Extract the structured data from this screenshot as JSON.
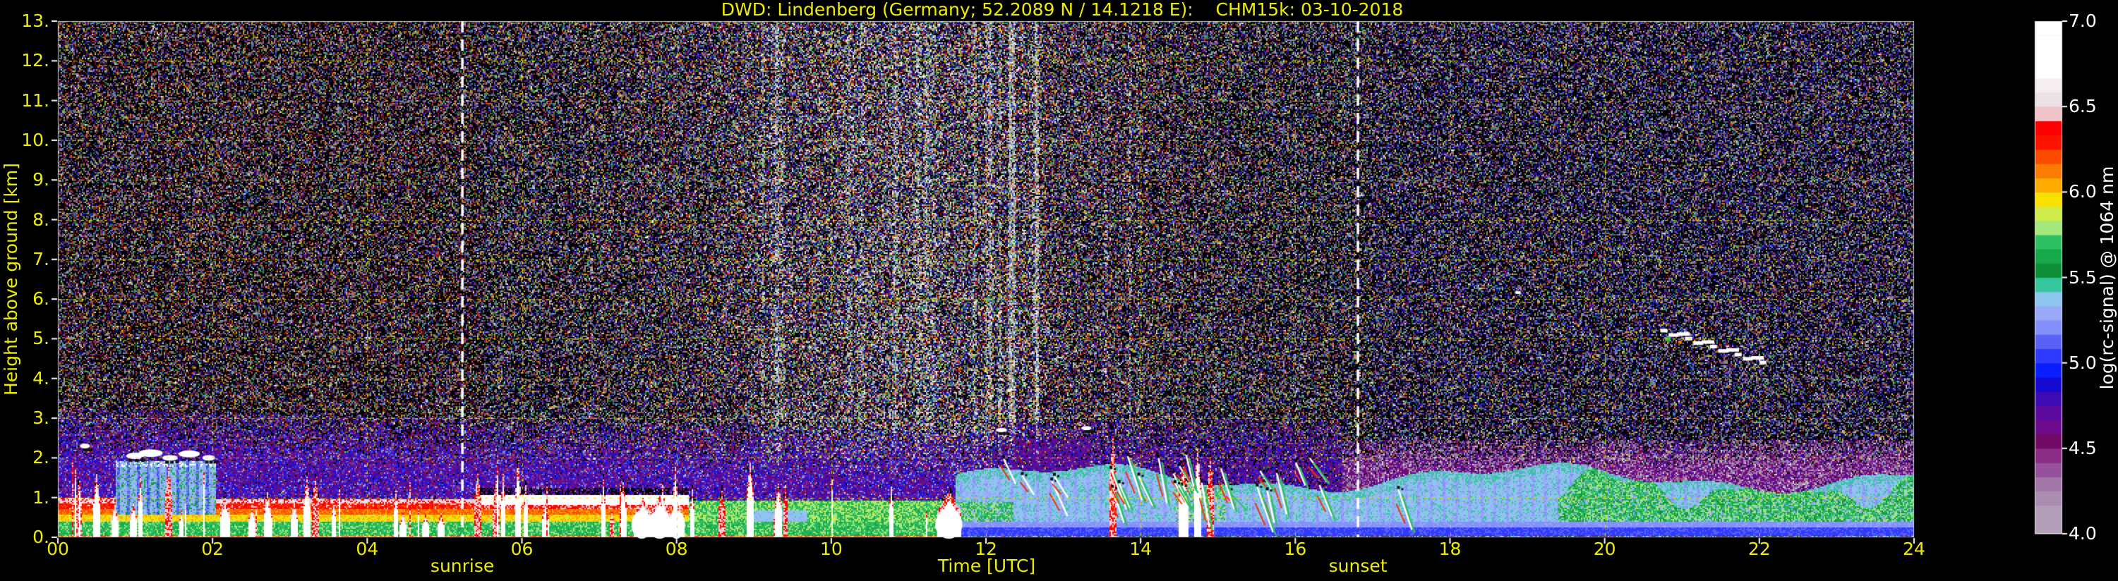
{
  "figure": {
    "background": "#000000",
    "label_color": "#eded00",
    "colorbar_text_color": "#ffffff"
  },
  "chart_data": {
    "type": "heatmap",
    "title": "DWD: Lindenberg (Germany; 52.2089 N / 14.1218 E):    CHM15k: 03-10-2018",
    "station": "Lindenberg (Germany)",
    "latitude": "52.2089 N",
    "longitude": "14.1218 E",
    "instrument": "CHM15k",
    "date": "03-10-2018",
    "xlabel": "Time [UTC]",
    "ylabel": "Height above ground [km]",
    "colorbar_label": "log(rc-signal) @ 1064 nm",
    "xlim": [
      0,
      24
    ],
    "ylim": [
      0,
      13
    ],
    "x_tick_values": [
      0,
      2,
      4,
      6,
      8,
      10,
      12,
      14,
      16,
      18,
      20,
      22,
      24
    ],
    "x_tick_labels": [
      "00",
      "02",
      "04",
      "06",
      "08",
      "10",
      "12",
      "14",
      "16",
      "18",
      "20",
      "22",
      "24"
    ],
    "y_tick_values": [
      0,
      1,
      2,
      3,
      4,
      5,
      6,
      7,
      8,
      9,
      10,
      11,
      12,
      13
    ],
    "y_tick_labels": [
      "0.",
      "1.",
      "2.",
      "3.",
      "4.",
      "5.",
      "6.",
      "7.",
      "8.",
      "9.",
      "10.",
      "11.",
      "12.",
      "13."
    ],
    "colorbar_range": [
      4.0,
      7.0
    ],
    "colorbar_tick_values": [
      4.0,
      4.5,
      5.0,
      5.5,
      6.0,
      6.5,
      7.0
    ],
    "colorbar_tick_labels": [
      "4.0",
      "4.5",
      "5.0",
      "5.5",
      "6.0",
      "6.5",
      "7.0"
    ],
    "colormap_colors": [
      "#b3a0b8",
      "#b3a0b8",
      "#ab8db1",
      "#a277a8",
      "#95519b",
      "#8c2d85",
      "#730b66",
      "#6e0b8c",
      "#5c0b9e",
      "#3c0bb4",
      "#1509d2",
      "#0a1eff",
      "#2f3bff",
      "#5a62f5",
      "#8490fb",
      "#9aa8f8",
      "#8ec6f0",
      "#35c79b",
      "#0e8f3a",
      "#16a849",
      "#2fbf63",
      "#a5e77c",
      "#cfec4a",
      "#f8e000",
      "#fdab00",
      "#fb7c00",
      "#fb4a00",
      "#fa1400",
      "#fa0000",
      "#efc3c8",
      "#ece2e6",
      "#f5eef0",
      "#ffffff",
      "#ffffff",
      "#ffffff",
      "#ffffff"
    ],
    "grid": {
      "color": "#dede00",
      "style": "dashed",
      "x_step_hours": 2,
      "y_step_km": 1
    },
    "annotations": [
      {
        "label": "sunrise",
        "time_utc": 5.23,
        "line_style": "dashed",
        "line_color": "#ffffff"
      },
      {
        "label": "sunset",
        "time_utc": 16.81,
        "line_style": "dashed",
        "line_color": "#ffffff"
      }
    ],
    "layers": {
      "boundary_layer_top_km": {
        "hours": [
          0,
          1,
          2,
          3,
          4,
          5,
          6,
          7,
          8,
          9,
          10,
          11,
          12,
          13,
          14,
          15,
          16,
          17,
          18,
          19,
          20,
          21,
          22,
          23,
          24
        ],
        "top": [
          1.0,
          1.9,
          0.95,
          0.95,
          0.95,
          1.0,
          1.1,
          1.1,
          0.9,
          0.9,
          0.9,
          0.95,
          1.5,
          1.7,
          1.6,
          1.8,
          1.6,
          1.5,
          1.6,
          1.4,
          1.5,
          1.6,
          1.4,
          1.3,
          1.4
        ]
      },
      "noise_bright_band_hours": [
        8.5,
        13.8
      ],
      "purple_noise_band_km": [
        1.0,
        3.2
      ],
      "evening_maroon_band_km": [
        1.4,
        2.45
      ],
      "plumes": [
        {
          "t": 0.25,
          "h": 1.3,
          "w": 2,
          "type": "red"
        },
        {
          "t": 0.5,
          "h": 1.6,
          "w": 2,
          "type": "white"
        },
        {
          "t": 2.15,
          "h": 1.0,
          "w": 3,
          "type": "white"
        },
        {
          "t": 2.5,
          "h": 0.75,
          "w": 2,
          "type": "white"
        },
        {
          "t": 3.05,
          "h": 0.85,
          "w": 2,
          "type": "white"
        },
        {
          "t": 4.45,
          "h": 0.6,
          "w": 2,
          "type": "white"
        },
        {
          "t": 6.3,
          "h": 0.85,
          "w": 2,
          "type": "white"
        },
        {
          "t": 7.55,
          "h": 1.0,
          "w": 6,
          "type": "white"
        },
        {
          "t": 7.78,
          "h": 1.05,
          "w": 7,
          "type": "white"
        },
        {
          "t": 8.0,
          "h": 0.9,
          "w": 5,
          "type": "white"
        },
        {
          "t": 11.52,
          "h": 1.15,
          "w": 8,
          "type": "white"
        },
        {
          "t": 13.63,
          "h": 2.55,
          "w": 2,
          "type": "red"
        },
        {
          "t": 14.55,
          "h": 1.9,
          "w": 3,
          "type": "white"
        },
        {
          "t": 14.72,
          "h": 2.25,
          "w": 2,
          "type": "white"
        },
        {
          "t": 14.9,
          "h": 2.0,
          "w": 2,
          "type": "red"
        }
      ],
      "clouds_low": [
        {
          "t": 0.35,
          "h": 2.3,
          "w": 14,
          "hh": 7
        },
        {
          "t": 1.0,
          "h": 2.05,
          "w": 26,
          "hh": 9
        },
        {
          "t": 1.2,
          "h": 2.12,
          "w": 34,
          "hh": 11
        },
        {
          "t": 1.45,
          "h": 2.0,
          "w": 22,
          "hh": 8
        },
        {
          "t": 1.7,
          "h": 2.1,
          "w": 30,
          "hh": 10
        },
        {
          "t": 1.95,
          "h": 2.0,
          "w": 18,
          "hh": 8
        },
        {
          "t": 12.2,
          "h": 2.7,
          "w": 16,
          "hh": 6
        },
        {
          "t": 13.3,
          "h": 2.75,
          "w": 14,
          "hh": 6
        }
      ],
      "cirrus_streak": {
        "t_start": 20.72,
        "h_start": 5.25,
        "t_end": 22.0,
        "h_end": 4.45
      },
      "isolated_speck": {
        "t": 18.85,
        "h": 6.2
      }
    }
  }
}
